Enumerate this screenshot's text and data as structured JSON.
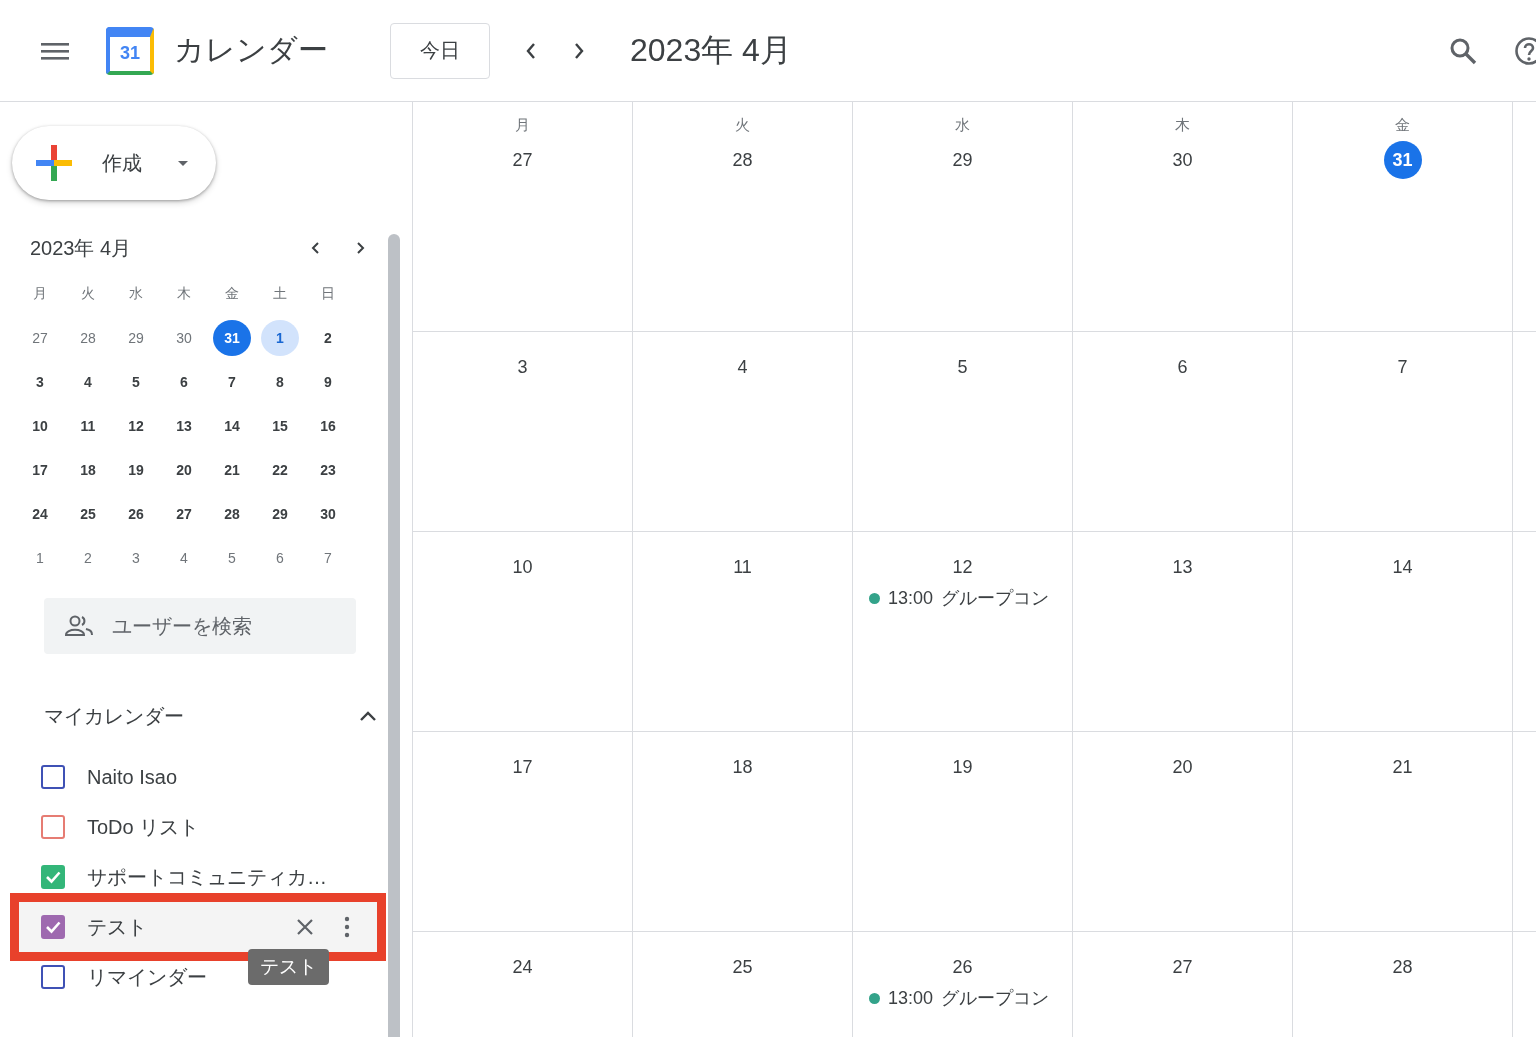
{
  "header": {
    "app_title": "カレンダー",
    "logo_text": "31",
    "today_button": "今日",
    "period": "2023年 4月"
  },
  "sidebar": {
    "create_button": "作成",
    "mini_calendar": {
      "title": "2023年 4月",
      "weekdays": [
        "月",
        "火",
        "水",
        "木",
        "金",
        "土",
        "日"
      ],
      "weeks": [
        [
          {
            "day": "27",
            "muted": true,
            "today": false,
            "selected": false
          },
          {
            "day": "28",
            "muted": true,
            "today": false,
            "selected": false
          },
          {
            "day": "29",
            "muted": true,
            "today": false,
            "selected": false
          },
          {
            "day": "30",
            "muted": true,
            "today": false,
            "selected": false
          },
          {
            "day": "31",
            "muted": true,
            "today": true,
            "selected": false
          },
          {
            "day": "1",
            "muted": false,
            "today": false,
            "selected": true
          },
          {
            "day": "2",
            "muted": false,
            "today": false,
            "selected": false
          }
        ],
        [
          {
            "day": "3",
            "muted": false,
            "today": false,
            "selected": false
          },
          {
            "day": "4",
            "muted": false,
            "today": false,
            "selected": false
          },
          {
            "day": "5",
            "muted": false,
            "today": false,
            "selected": false
          },
          {
            "day": "6",
            "muted": false,
            "today": false,
            "selected": false
          },
          {
            "day": "7",
            "muted": false,
            "today": false,
            "selected": false
          },
          {
            "day": "8",
            "muted": false,
            "today": false,
            "selected": false
          },
          {
            "day": "9",
            "muted": false,
            "today": false,
            "selected": false
          }
        ],
        [
          {
            "day": "10",
            "muted": false,
            "today": false,
            "selected": false
          },
          {
            "day": "11",
            "muted": false,
            "today": false,
            "selected": false
          },
          {
            "day": "12",
            "muted": false,
            "today": false,
            "selected": false
          },
          {
            "day": "13",
            "muted": false,
            "today": false,
            "selected": false
          },
          {
            "day": "14",
            "muted": false,
            "today": false,
            "selected": false
          },
          {
            "day": "15",
            "muted": false,
            "today": false,
            "selected": false
          },
          {
            "day": "16",
            "muted": false,
            "today": false,
            "selected": false
          }
        ],
        [
          {
            "day": "17",
            "muted": false,
            "today": false,
            "selected": false
          },
          {
            "day": "18",
            "muted": false,
            "today": false,
            "selected": false
          },
          {
            "day": "19",
            "muted": false,
            "today": false,
            "selected": false
          },
          {
            "day": "20",
            "muted": false,
            "today": false,
            "selected": false
          },
          {
            "day": "21",
            "muted": false,
            "today": false,
            "selected": false
          },
          {
            "day": "22",
            "muted": false,
            "today": false,
            "selected": false
          },
          {
            "day": "23",
            "muted": false,
            "today": false,
            "selected": false
          }
        ],
        [
          {
            "day": "24",
            "muted": false,
            "today": false,
            "selected": false
          },
          {
            "day": "25",
            "muted": false,
            "today": false,
            "selected": false
          },
          {
            "day": "26",
            "muted": false,
            "today": false,
            "selected": false
          },
          {
            "day": "27",
            "muted": false,
            "today": false,
            "selected": false
          },
          {
            "day": "28",
            "muted": false,
            "today": false,
            "selected": false
          },
          {
            "day": "29",
            "muted": false,
            "today": false,
            "selected": false
          },
          {
            "day": "30",
            "muted": false,
            "today": false,
            "selected": false
          }
        ],
        [
          {
            "day": "1",
            "muted": true,
            "today": false,
            "selected": false
          },
          {
            "day": "2",
            "muted": true,
            "today": false,
            "selected": false
          },
          {
            "day": "3",
            "muted": true,
            "today": false,
            "selected": false
          },
          {
            "day": "4",
            "muted": true,
            "today": false,
            "selected": false
          },
          {
            "day": "5",
            "muted": true,
            "today": false,
            "selected": false
          },
          {
            "day": "6",
            "muted": true,
            "today": false,
            "selected": false
          },
          {
            "day": "7",
            "muted": true,
            "today": false,
            "selected": false
          }
        ]
      ]
    },
    "people_search": {
      "placeholder": "ユーザーを検索"
    },
    "my_calendars": {
      "title": "マイカレンダー",
      "expanded": true,
      "items": [
        {
          "label": "Naito Isao",
          "checked": false,
          "color": "#3f51b5",
          "hovered": false,
          "highlighted": false
        },
        {
          "label": "ToDo リスト",
          "checked": false,
          "color": "#e67c73",
          "hovered": false,
          "highlighted": false
        },
        {
          "label": "サポートコミュニティカ…",
          "checked": true,
          "color": "#33b679",
          "hovered": false,
          "highlighted": false
        },
        {
          "label": "テスト",
          "checked": true,
          "color": "#9e69af",
          "hovered": true,
          "highlighted": true
        },
        {
          "label": "リマインダー",
          "checked": false,
          "color": "#3f51b5",
          "hovered": false,
          "highlighted": false
        }
      ]
    },
    "tooltip": "テスト"
  },
  "month": {
    "weekdays": [
      "月",
      "火",
      "水",
      "木",
      "金"
    ],
    "weeks": [
      [
        {
          "day": "27",
          "today": false
        },
        {
          "day": "28",
          "today": false
        },
        {
          "day": "29",
          "today": false
        },
        {
          "day": "30",
          "today": false
        },
        {
          "day": "31",
          "today": true
        }
      ],
      [
        {
          "day": "3",
          "today": false
        },
        {
          "day": "4",
          "today": false
        },
        {
          "day": "5",
          "today": false
        },
        {
          "day": "6",
          "today": false
        },
        {
          "day": "7",
          "today": false
        }
      ],
      [
        {
          "day": "10",
          "today": false
        },
        {
          "day": "11",
          "today": false
        },
        {
          "day": "12",
          "today": false,
          "events": [
            {
              "time": "13:00",
              "title": "グループコン",
              "color": "#33a38a"
            }
          ]
        },
        {
          "day": "13",
          "today": false
        },
        {
          "day": "14",
          "today": false
        }
      ],
      [
        {
          "day": "17",
          "today": false
        },
        {
          "day": "18",
          "today": false
        },
        {
          "day": "19",
          "today": false
        },
        {
          "day": "20",
          "today": false
        },
        {
          "day": "21",
          "today": false
        }
      ],
      [
        {
          "day": "24",
          "today": false
        },
        {
          "day": "25",
          "today": false
        },
        {
          "day": "26",
          "today": false,
          "events": [
            {
              "time": "13:00",
              "title": "グループコン",
              "color": "#33a38a"
            }
          ]
        },
        {
          "day": "27",
          "today": false
        },
        {
          "day": "28",
          "today": false
        }
      ]
    ]
  }
}
